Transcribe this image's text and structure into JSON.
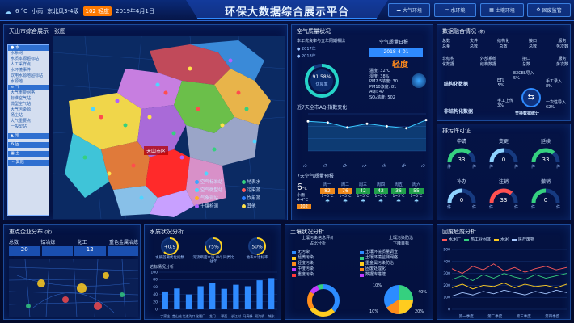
{
  "header": {
    "temp": "6 °C",
    "weather": "小雨",
    "wind": "东北风3-4级",
    "aqi_badge": "102 轻度",
    "date": "2019年4月1日",
    "title": "环保大数据综合展示平台",
    "nav": [
      {
        "label": "大气环境",
        "icon": "cloud-icon"
      },
      {
        "label": "水环境",
        "icon": "water-icon"
      },
      {
        "label": "土壤环境",
        "icon": "soil-icon"
      },
      {
        "label": "固废监管",
        "icon": "waste-icon"
      }
    ],
    "colors": {
      "accent": "#2f8bff",
      "badge": "#ff7a00",
      "title": "#e6f3ff"
    }
  },
  "map_panel": {
    "title": "天山市综合展示一张图",
    "city_label": "天山市区",
    "menu": {
      "water_title": "水",
      "water_items": [
        "水系网",
        "水质本源超标站",
        "人工采样点",
        "水环境事件",
        "饮用水源地超标站",
        "水源地"
      ],
      "air_title": "气",
      "air_items": [
        "大气重要网格",
        "标准空气站",
        "微型空气站",
        "大气污染源",
        "扬尘站",
        "大气重要点",
        "一般型站"
      ],
      "soil_title": "污",
      "waste_title": "固",
      "soil2_title": "土",
      "other_title": "其他"
    },
    "legend": [
      {
        "label": "空气标准站",
        "color": "#3aa6ff",
        "icon": "air-station-icon"
      },
      {
        "label": "地表水",
        "color": "#35d07f",
        "icon": "surface-water-icon"
      },
      {
        "label": "空气微型站",
        "color": "#4fd5ff",
        "icon": "micro-station-icon"
      },
      {
        "label": "污染源",
        "color": "#ff5a5a",
        "icon": "pollution-source-icon"
      },
      {
        "label": "气象测站",
        "color": "#ffb020",
        "icon": "weather-station-icon"
      },
      {
        "label": "饮用源",
        "color": "#2d7cff",
        "icon": "drinking-source-icon"
      },
      {
        "label": "土壤检测",
        "color": "#b060ff",
        "icon": "soil-monitor-icon"
      },
      {
        "label": "其他",
        "color": "#ffe24a",
        "icon": "other-icon"
      }
    ]
  },
  "air_panel": {
    "title": "空气质量状况",
    "compare_title": "本年优良率与五年同期相比",
    "year_a": "2017年",
    "year_b": "2018年",
    "rate": "91.58%",
    "rate_label": "优良率",
    "rate_fraction": 0.9158,
    "daily_title": "空气质量日报",
    "daily_date": "2018-4-01",
    "daily_level": "轻度",
    "daily_rows": [
      "温度: 32°C",
      "湿度: 38%",
      "PM2.5浓度: 30",
      "PM10浓度: 81",
      "AQI: 47",
      "SO₂浓度: 502"
    ],
    "trend_title": "近7天全市AQI指数变化",
    "trend_dates": [
      "2019-04-01",
      "2019-04-02",
      "2019-04-03",
      "2019-04-04",
      "2019-04-05",
      "2019-04-06",
      "2019-04-07"
    ],
    "trend_values": [
      120,
      115,
      95,
      110,
      100,
      92,
      125
    ],
    "forecast_title": "7天空气质量预报",
    "today_temp": "6",
    "today_unit": "°C",
    "today_desc": "小雨",
    "today_sub": "4-4°C",
    "today_aqi": "102",
    "forecast": [
      {
        "day": "周一",
        "aqi": "82",
        "range": "1~5°C",
        "color": "#f08a1c"
      },
      {
        "day": "周二",
        "aqi": "76",
        "range": "1~5°C",
        "color": "#f08a1c"
      },
      {
        "day": "周三",
        "aqi": "42",
        "range": "1~5°C",
        "color": "#20a04a"
      },
      {
        "day": "周四",
        "aqi": "42",
        "range": "1~5°C",
        "color": "#20a04a"
      },
      {
        "day": "周五",
        "aqi": "36",
        "range": "1~5°C",
        "color": "#20a04a"
      },
      {
        "day": "周六",
        "aqi": "55",
        "range": "1~5°C",
        "color": "#20a04a"
      }
    ]
  },
  "data_panel": {
    "title": "数据融合情况",
    "unit": "(条)",
    "stats": [
      {
        "top": "总数",
        "bottom": "总量"
      },
      {
        "top": "文件",
        "bottom": "总数"
      },
      {
        "top": "结构化",
        "bottom": "总数"
      },
      {
        "top": "接口",
        "bottom": "总数"
      },
      {
        "top": "服务",
        "bottom": "务次数"
      }
    ],
    "row2": [
      {
        "top": "非结构",
        "bottom": "化数据"
      },
      {
        "top": "外部系统",
        "bottom": "结构数据"
      },
      {
        "top": "接口",
        "bottom": "总数"
      },
      {
        "top": "服务",
        "bottom": "务次数"
      }
    ],
    "struct_label": "结构化数据",
    "unstruct_label": "非结构化数据",
    "etl": "ETL",
    "etl_val": "5%",
    "excel": "EXCEL导入",
    "excel_val": "5%",
    "manual": "手工录入",
    "manual_val": "8%",
    "upload": "手工上传",
    "upload_val": "3%",
    "once": "一次性导入",
    "once_val": "62%",
    "exchange": "交换数据统计"
  },
  "permit_panel": {
    "title": "排污许可证",
    "row1": [
      {
        "label": "申请",
        "value": "33",
        "unit": "件",
        "color": "#35d07f",
        "fraction": 0.72
      },
      {
        "label": "变更",
        "value": "0",
        "unit": "件",
        "color": "#8fd3ff",
        "fraction": 0.5
      },
      {
        "label": "延续",
        "value": "33",
        "unit": "件",
        "color": "#35d07f",
        "fraction": 0.72
      }
    ],
    "row2": [
      {
        "label": "补办",
        "value": "0",
        "unit": "件",
        "color": "#8fd3ff",
        "fraction": 0.5
      },
      {
        "label": "注销",
        "value": "33",
        "unit": "件",
        "color": "#ff5050",
        "fraction": 0.72
      },
      {
        "label": "撤销",
        "value": "0",
        "unit": "件",
        "color": "#35d07f",
        "fraction": 0.5
      }
    ]
  },
  "enterprise_panel": {
    "title": "重点企业分布",
    "unit": "(家)",
    "headers": [
      "总数",
      "铝冶炼",
      "化工",
      "重色金属冶炼"
    ],
    "values": [
      "20",
      "",
      "12",
      ""
    ]
  },
  "water_panel": {
    "title": "水质状况分析",
    "gauges": [
      {
        "value": "+0.9",
        "label": "水质首要优化指数",
        "fraction": 0.62
      },
      {
        "value": "75%",
        "label": "河流断面水质 (Ⅳ) 同类比往年",
        "fraction": 0.75
      },
      {
        "value": "50%",
        "label": "地表水达标率",
        "fraction": 0.5
      }
    ],
    "chart_title": "达标情况分析",
    "y_ticks": [
      "100",
      "80",
      "60",
      "40",
      "20",
      "0"
    ]
  },
  "soil_panel": {
    "title": "土壤状况分析",
    "left_title": "土壤污染信息评价",
    "left_sub": "占比分析",
    "right_title": "土壤污染防治",
    "right_sub": "下降目标",
    "legend_left": [
      {
        "label": "无污染",
        "color": "#2c8cff"
      },
      {
        "label": "轻微污染",
        "color": "#ffcc1f"
      },
      {
        "label": "轻度污染",
        "color": "#ff8c1a"
      },
      {
        "label": "中度污染",
        "color": "#c23cff"
      },
      {
        "label": "重度污染",
        "color": "#ff3a3a"
      }
    ],
    "legend_right": [
      {
        "label": "土壤环境质量调查",
        "color": "#2c8cff"
      },
      {
        "label": "土壤环境监测网络",
        "color": "#35d07f"
      },
      {
        "label": "重金属污染防治",
        "color": "#ffcc1f"
      },
      {
        "label": "固废处理化",
        "color": "#ff8c1a"
      },
      {
        "label": "数据库搭建",
        "color": "#c23cff"
      }
    ],
    "pie_labels": [
      "10%",
      "40%",
      "20%",
      "10%"
    ]
  },
  "waste_panel": {
    "title": "固废危废分析",
    "legend": [
      {
        "label": "水泥厂",
        "color": "#ff5a5a"
      },
      {
        "label": "热工业固体",
        "color": "#35d07f"
      },
      {
        "label": "水泥",
        "color": "#ffcc1f"
      },
      {
        "label": "医疗废物",
        "color": "#a7c8ff"
      }
    ],
    "x_labels": [
      "第一季度",
      "第二季度",
      "第三季度",
      "第四季度"
    ],
    "y_ticks": [
      "500",
      "400",
      "300",
      "200",
      "100",
      "0"
    ]
  },
  "chart_data": [
    {
      "type": "line",
      "title": "近7天全市AQI指数变化",
      "x": [
        "2019-04-01",
        "2019-04-02",
        "2019-04-03",
        "2019-04-04",
        "2019-04-05",
        "2019-04-06",
        "2019-04-07"
      ],
      "series": [
        {
          "values": [
            120,
            115,
            95,
            110,
            100,
            92,
            125
          ]
        }
      ],
      "ylim": [
        0,
        150
      ]
    },
    {
      "type": "bar",
      "title": "达标情况分析",
      "categories": [
        "丁家庄",
        "昔山站",
        "北道沟口",
        "化肥厂",
        "龙门",
        "鄂西",
        "长江村",
        "马高峰",
        "双沟桥",
        "城东"
      ],
      "values": [
        48,
        56,
        40,
        62,
        70,
        55,
        66,
        62,
        78,
        84
      ],
      "ylim": [
        0,
        100
      ]
    },
    {
      "type": "line",
      "title": "固废危废分析",
      "x": [
        "第一季度",
        "第二季度",
        "第三季度",
        "第四季度"
      ],
      "series": [
        {
          "name": "水泥厂",
          "values": [
            340,
            300,
            360,
            330,
            380,
            320,
            350,
            310,
            340,
            360,
            330,
            350
          ]
        },
        {
          "name": "热工业固体",
          "values": [
            250,
            280,
            240,
            290,
            260,
            300,
            270,
            250,
            290,
            260,
            280,
            300
          ]
        },
        {
          "name": "水泥",
          "values": [
            180,
            210,
            170,
            200,
            190,
            220,
            180,
            210,
            190,
            200,
            180,
            210
          ]
        },
        {
          "name": "医疗废物",
          "values": [
            110,
            140,
            120,
            150,
            130,
            160,
            140,
            120,
            150,
            130,
            160,
            140
          ]
        }
      ],
      "ylim": [
        0,
        500
      ]
    }
  ]
}
